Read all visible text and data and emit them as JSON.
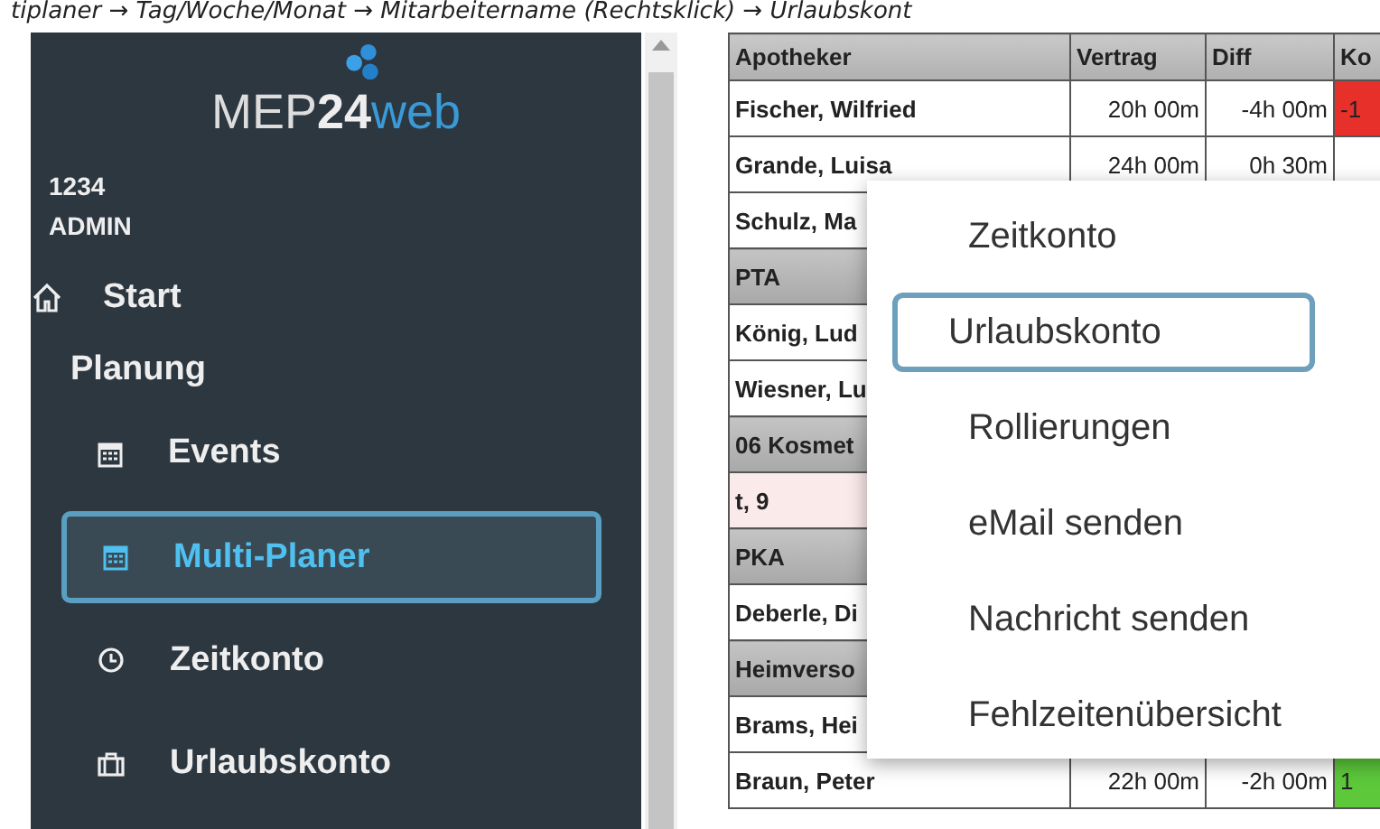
{
  "caption": "tiplaner → Tag/Woche/Monat → Mitarbeitername (Rechtsklick) → Urlaubskont",
  "sidebar": {
    "logo": {
      "part_1": "MEP",
      "part_2": "24",
      "part_3": "web"
    },
    "user": {
      "id": "1234",
      "role": "ADMIN"
    },
    "items": [
      {
        "kind": "home",
        "label": "Start",
        "selected": false
      },
      {
        "kind": "section",
        "label": "Planung"
      },
      {
        "kind": "calendar",
        "label": "Events",
        "selected": false
      },
      {
        "kind": "calendar",
        "label": "Multi-Planer",
        "selected": true
      },
      {
        "kind": "clock",
        "label": "Zeitkonto",
        "selected": false
      },
      {
        "kind": "briefcase",
        "label": "Urlaubskonto",
        "selected": false
      }
    ]
  },
  "table": {
    "columns": [
      "Apotheker",
      "Vertrag",
      "Diff",
      "Ko"
    ],
    "rows": [
      {
        "kind": "person",
        "cells": [
          "Fischer, Wilfried",
          "20h 00m",
          "-4h 00m",
          "-1"
        ],
        "color": "#e8302a"
      },
      {
        "kind": "person",
        "cells": [
          "Grande, Luisa",
          "24h 00m",
          "0h 30m"
        ]
      },
      {
        "kind": "person",
        "cells": [
          "Schulz, Ma"
        ]
      },
      {
        "kind": "group",
        "cells": [
          "PTA"
        ]
      },
      {
        "kind": "person",
        "cells": [
          "König, Lud"
        ]
      },
      {
        "kind": "person",
        "cells": [
          "Wiesner, Lu"
        ]
      },
      {
        "kind": "group",
        "cells": [
          "06 Kosmet"
        ]
      },
      {
        "kind": "absent",
        "cells": [
          "t, 9"
        ]
      },
      {
        "kind": "group",
        "cells": [
          "PKA"
        ]
      },
      {
        "kind": "person",
        "cells": [
          "Deberle, Di"
        ]
      },
      {
        "kind": "group",
        "cells": [
          "Heimverso"
        ]
      },
      {
        "kind": "person",
        "cells": [
          "Brams, Hei"
        ]
      },
      {
        "kind": "person",
        "cells": [
          "Braun, Peter",
          "22h 00m",
          "-2h 00m",
          "1"
        ],
        "color": "#5cc83a"
      }
    ]
  },
  "context_menu": {
    "items": [
      {
        "label": "Zeitkonto",
        "selected": false
      },
      {
        "label": "Urlaubskonto",
        "selected": true
      },
      {
        "label": "Rollierungen",
        "selected": false
      },
      {
        "label": "eMail senden",
        "selected": false
      },
      {
        "label": "Nachricht senden",
        "selected": false
      },
      {
        "label": "Fehlzeitenübersicht",
        "selected": false
      }
    ]
  }
}
